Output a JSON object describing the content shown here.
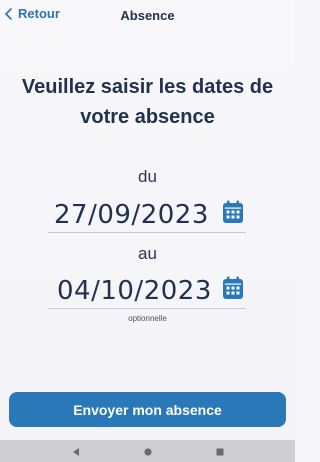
{
  "header": {
    "back_label": "Retour",
    "title": "Absence"
  },
  "main": {
    "heading": "Veuillez saisir les dates de votre absence",
    "from_label": "du",
    "from_date": "27/09/2023",
    "to_label": "au",
    "to_date": "04/10/2023",
    "to_helper": "optionnelle",
    "submit_label": "Envoyer mon absence"
  },
  "icons": {
    "back": "chevron-left-icon",
    "calendar": "calendar-icon",
    "nav_back": "triangle-left-icon",
    "nav_home": "circle-icon",
    "nav_recent": "square-icon"
  },
  "colors": {
    "accent": "#2a78b8",
    "link": "#2a73b8",
    "text": "#22314f",
    "background": "#f6f6fa",
    "nav_bar": "#cfcfd1"
  }
}
